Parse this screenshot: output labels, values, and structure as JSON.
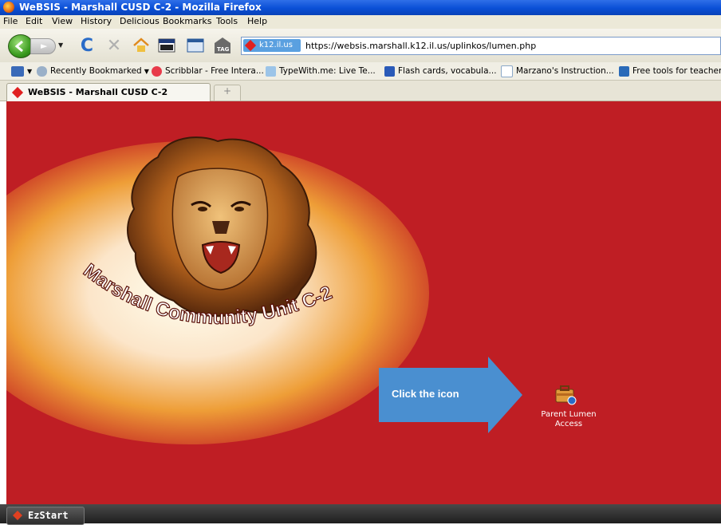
{
  "window": {
    "title": "WeBSIS - Marshall CUSD C-2 - Mozilla Firefox"
  },
  "menu": [
    "File",
    "Edit",
    "View",
    "History",
    "Delicious",
    "Bookmarks",
    "Tools",
    "Help"
  ],
  "nav": {
    "site_label": "k12.il.us",
    "url": "https://websis.marshall.k12.il.us/uplinkos/lumen.php",
    "tag_label": "TAG"
  },
  "bookmarks": [
    "Recently Bookmarked",
    "Scribblar - Free Intera...",
    "TypeWith.me: Live Te...",
    "Flash cards, vocabula...",
    "Marzano's Instruction...",
    "Free tools for teachers..."
  ],
  "tab": {
    "label": "WeBSIS - Marshall CUSD C-2",
    "new_tab": "+"
  },
  "page": {
    "logo_text": "Marshall Community Unit C-2",
    "arrow_text": "Click the icon",
    "icon_label_1": "Parent Lumen",
    "icon_label_2": "Access"
  },
  "taskbar": {
    "start_label": "EzStart"
  },
  "colors": {
    "page_background": "#bf1e24",
    "arrow": "#4a8fd0",
    "titlebar": "#0a4fd6"
  },
  "icons": [
    "firefox-icon",
    "back-arrow-icon",
    "forward-arrow-icon",
    "reload-icon",
    "stop-icon",
    "home-icon",
    "lion-logo",
    "briefcase-icon"
  ]
}
